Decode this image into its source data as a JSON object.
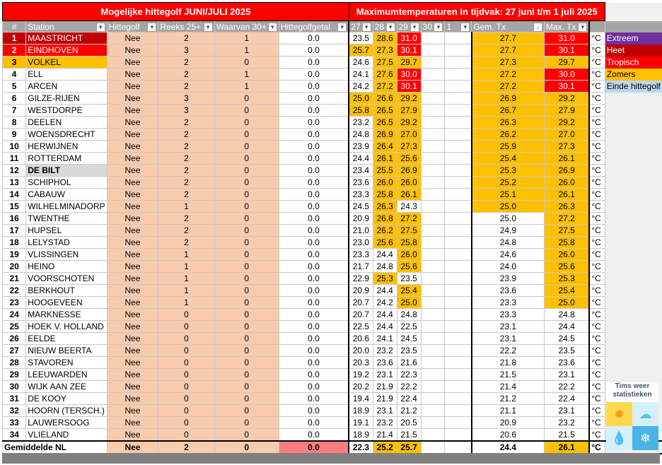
{
  "title_left": "Mogelijke hittegolf JUNI/JULI 2025",
  "title_right": "Maximumtemperaturen in tijdvak: 27 juni t/m 1 juli 2025",
  "headers": [
    "#",
    "Station",
    "Hittegolf",
    "Reeks 25+",
    "Waarvan 30+",
    "Hittegolfgetal",
    "27",
    "28",
    "29",
    "30",
    "1",
    "Gem. Tx",
    "Max. Tx"
  ],
  "sort_indicator": "↓",
  "unit": "°C",
  "legend": [
    {
      "label": "Extreem",
      "color": "#7030a0",
      "text": "#fff"
    },
    {
      "label": "Heet",
      "color": "#c00000",
      "text": "#fff"
    },
    {
      "label": "Tropisch",
      "color": "#ff0000",
      "text": "#fff"
    },
    {
      "label": "Zomers",
      "color": "#ffc000",
      "text": "#000"
    },
    {
      "label": "Einde hittegolf",
      "color": "#bdd7ee",
      "text": "#000"
    }
  ],
  "logo": {
    "line1": "Tims weer",
    "line2": "statistieken"
  },
  "rows": [
    {
      "n": "1",
      "station": "MAASTRICHT",
      "hg": "Nee",
      "reeks": "2",
      "w30": "1",
      "getal": "0.0",
      "d": [
        "23.5",
        "28.6",
        "31.0"
      ],
      "gem": "27.7",
      "max": "31.0",
      "rank": "heet"
    },
    {
      "n": "2",
      "station": "EINDHOVEN",
      "hg": "Nee",
      "reeks": "3",
      "w30": "1",
      "getal": "0.0",
      "d": [
        "25.7",
        "27.3",
        "30.1"
      ],
      "gem": "27.7",
      "max": "30.1",
      "rank": "trop"
    },
    {
      "n": "3",
      "station": "VOLKEL",
      "hg": "Nee",
      "reeks": "2",
      "w30": "0",
      "getal": "0.0",
      "d": [
        "24.6",
        "27.5",
        "29.7"
      ],
      "gem": "27.3",
      "max": "29.7",
      "rank": "zom"
    },
    {
      "n": "4",
      "station": "ELL",
      "hg": "Nee",
      "reeks": "2",
      "w30": "1",
      "getal": "0.0",
      "d": [
        "24.1",
        "27.6",
        "30.0"
      ],
      "gem": "27.2",
      "max": "30.0"
    },
    {
      "n": "5",
      "station": "ARCEN",
      "hg": "Nee",
      "reeks": "2",
      "w30": "1",
      "getal": "0.0",
      "d": [
        "24.2",
        "27.2",
        "30.1"
      ],
      "gem": "27.2",
      "max": "30.1"
    },
    {
      "n": "6",
      "station": "GILZE-RIJEN",
      "hg": "Nee",
      "reeks": "3",
      "w30": "0",
      "getal": "0.0",
      "d": [
        "25.0",
        "26.6",
        "29.2"
      ],
      "gem": "26.9",
      "max": "29.2"
    },
    {
      "n": "7",
      "station": "WESTDORPE",
      "hg": "Nee",
      "reeks": "3",
      "w30": "0",
      "getal": "0.0",
      "d": [
        "25.8",
        "26.5",
        "27.9"
      ],
      "gem": "26.7",
      "max": "27.9"
    },
    {
      "n": "8",
      "station": "DEELEN",
      "hg": "Nee",
      "reeks": "2",
      "w30": "0",
      "getal": "0.0",
      "d": [
        "23.2",
        "26.5",
        "29.2"
      ],
      "gem": "26.3",
      "max": "29.2"
    },
    {
      "n": "9",
      "station": "WOENSDRECHT",
      "hg": "Nee",
      "reeks": "2",
      "w30": "0",
      "getal": "0.0",
      "d": [
        "24.8",
        "26.9",
        "27.0"
      ],
      "gem": "26.2",
      "max": "27.0"
    },
    {
      "n": "10",
      "station": "HERWIJNEN",
      "hg": "Nee",
      "reeks": "2",
      "w30": "0",
      "getal": "0.0",
      "d": [
        "23.9",
        "26.4",
        "27.3"
      ],
      "gem": "25.9",
      "max": "27.3"
    },
    {
      "n": "11",
      "station": "ROTTERDAM",
      "hg": "Nee",
      "reeks": "2",
      "w30": "0",
      "getal": "0.0",
      "d": [
        "24.4",
        "26.1",
        "25.6"
      ],
      "gem": "25.4",
      "max": "26.1"
    },
    {
      "n": "12",
      "station": "DE BILT",
      "hg": "Nee",
      "reeks": "2",
      "w30": "0",
      "getal": "0.0",
      "d": [
        "23.4",
        "25.5",
        "26.9"
      ],
      "gem": "25.3",
      "max": "26.9",
      "rank": "bilt"
    },
    {
      "n": "13",
      "station": "SCHIPHOL",
      "hg": "Nee",
      "reeks": "2",
      "w30": "0",
      "getal": "0.0",
      "d": [
        "23.6",
        "26.0",
        "26.0"
      ],
      "gem": "25.2",
      "max": "26.0"
    },
    {
      "n": "14",
      "station": "CABAUW",
      "hg": "Nee",
      "reeks": "2",
      "w30": "0",
      "getal": "0.0",
      "d": [
        "23.3",
        "25.8",
        "26.1"
      ],
      "gem": "25.1",
      "max": "26.1"
    },
    {
      "n": "15",
      "station": "WILHELMINADORP",
      "hg": "Nee",
      "reeks": "1",
      "w30": "0",
      "getal": "0.0",
      "d": [
        "24.5",
        "26.3",
        "24.3"
      ],
      "gem": "25.0",
      "max": "26.3"
    },
    {
      "n": "16",
      "station": "TWENTHE",
      "hg": "Nee",
      "reeks": "2",
      "w30": "0",
      "getal": "0.0",
      "d": [
        "20.9",
        "26.8",
        "27.2"
      ],
      "gem": "25.0",
      "max": "27.2"
    },
    {
      "n": "17",
      "station": "HUPSEL",
      "hg": "Nee",
      "reeks": "2",
      "w30": "0",
      "getal": "0.0",
      "d": [
        "21.0",
        "26.2",
        "27.5"
      ],
      "gem": "24.9",
      "max": "27.5"
    },
    {
      "n": "18",
      "station": "LELYSTAD",
      "hg": "Nee",
      "reeks": "2",
      "w30": "0",
      "getal": "0.0",
      "d": [
        "23.0",
        "25.6",
        "25.8"
      ],
      "gem": "24.8",
      "max": "25.8"
    },
    {
      "n": "19",
      "station": "VLISSINGEN",
      "hg": "Nee",
      "reeks": "1",
      "w30": "0",
      "getal": "0.0",
      "d": [
        "23.3",
        "24.4",
        "26.0"
      ],
      "gem": "24.6",
      "max": "26.0"
    },
    {
      "n": "20",
      "station": "HEINO",
      "hg": "Nee",
      "reeks": "1",
      "w30": "0",
      "getal": "0.0",
      "d": [
        "21.7",
        "24.8",
        "25.6"
      ],
      "gem": "24.0",
      "max": "25.6"
    },
    {
      "n": "21",
      "station": "VOORSCHOTEN",
      "hg": "Nee",
      "reeks": "1",
      "w30": "0",
      "getal": "0.0",
      "d": [
        "22.9",
        "25.3",
        "23.5"
      ],
      "gem": "23.9",
      "max": "25.3"
    },
    {
      "n": "22",
      "station": "BERKHOUT",
      "hg": "Nee",
      "reeks": "1",
      "w30": "0",
      "getal": "0.0",
      "d": [
        "20.9",
        "24.4",
        "25.4"
      ],
      "gem": "23.6",
      "max": "25.4"
    },
    {
      "n": "23",
      "station": "HOOGEVEEN",
      "hg": "Nee",
      "reeks": "1",
      "w30": "0",
      "getal": "0.0",
      "d": [
        "20.7",
        "24.2",
        "25.0"
      ],
      "gem": "23.3",
      "max": "25.0"
    },
    {
      "n": "24",
      "station": "MARKNESSE",
      "hg": "Nee",
      "reeks": "0",
      "w30": "0",
      "getal": "0.0",
      "d": [
        "20.7",
        "24.4",
        "24.8"
      ],
      "gem": "23.3",
      "max": "24.8"
    },
    {
      "n": "25",
      "station": "HOEK V. HOLLAND",
      "hg": "Nee",
      "reeks": "0",
      "w30": "0",
      "getal": "0.0",
      "d": [
        "22.5",
        "24.4",
        "22.5"
      ],
      "gem": "23.1",
      "max": "24.4"
    },
    {
      "n": "26",
      "station": "EELDE",
      "hg": "Nee",
      "reeks": "0",
      "w30": "0",
      "getal": "0.0",
      "d": [
        "20.6",
        "24.1",
        "24.5"
      ],
      "gem": "23.1",
      "max": "24.5"
    },
    {
      "n": "27",
      "station": "NIEUW BEERTA",
      "hg": "Nee",
      "reeks": "0",
      "w30": "0",
      "getal": "0.0",
      "d": [
        "20.0",
        "23.2",
        "23.5"
      ],
      "gem": "22.2",
      "max": "23.5"
    },
    {
      "n": "28",
      "station": "STAVOREN",
      "hg": "Nee",
      "reeks": "0",
      "w30": "0",
      "getal": "0.0",
      "d": [
        "20.3",
        "23.6",
        "21.6"
      ],
      "gem": "21.8",
      "max": "23.6"
    },
    {
      "n": "29",
      "station": "LEEUWARDEN",
      "hg": "Nee",
      "reeks": "0",
      "w30": "0",
      "getal": "0.0",
      "d": [
        "19.2",
        "23.1",
        "22.3"
      ],
      "gem": "21.5",
      "max": "23.1"
    },
    {
      "n": "30",
      "station": "WIJK AAN ZEE",
      "hg": "Nee",
      "reeks": "0",
      "w30": "0",
      "getal": "0.0",
      "d": [
        "20.2",
        "21.9",
        "22.2"
      ],
      "gem": "21.4",
      "max": "22.2"
    },
    {
      "n": "31",
      "station": "DE KOOY",
      "hg": "Nee",
      "reeks": "0",
      "w30": "0",
      "getal": "0.0",
      "d": [
        "19.4",
        "21.9",
        "22.4"
      ],
      "gem": "21.2",
      "max": "22.4"
    },
    {
      "n": "32",
      "station": "HOORN (TERSCH.)",
      "hg": "Nee",
      "reeks": "0",
      "w30": "0",
      "getal": "0.0",
      "d": [
        "18.9",
        "23.1",
        "21.2"
      ],
      "gem": "21.1",
      "max": "23.1"
    },
    {
      "n": "33",
      "station": "LAUWERSOOG",
      "hg": "Nee",
      "reeks": "0",
      "w30": "0",
      "getal": "0.0",
      "d": [
        "19.1",
        "23.2",
        "20.5"
      ],
      "gem": "20.9",
      "max": "23.2"
    },
    {
      "n": "34",
      "station": "VLIELAND",
      "hg": "Nee",
      "reeks": "0",
      "w30": "0",
      "getal": "0.0",
      "d": [
        "18.9",
        "21.4",
        "21.5"
      ],
      "gem": "20.6",
      "max": "21.5"
    }
  ],
  "total": {
    "label": "Gemiddelde NL",
    "hg": "Nee",
    "reeks": "2",
    "w30": "0",
    "getal": "0.0",
    "d": [
      "22.3",
      "25.2",
      "25.7"
    ],
    "gem": "24.4",
    "max": "26.1"
  }
}
